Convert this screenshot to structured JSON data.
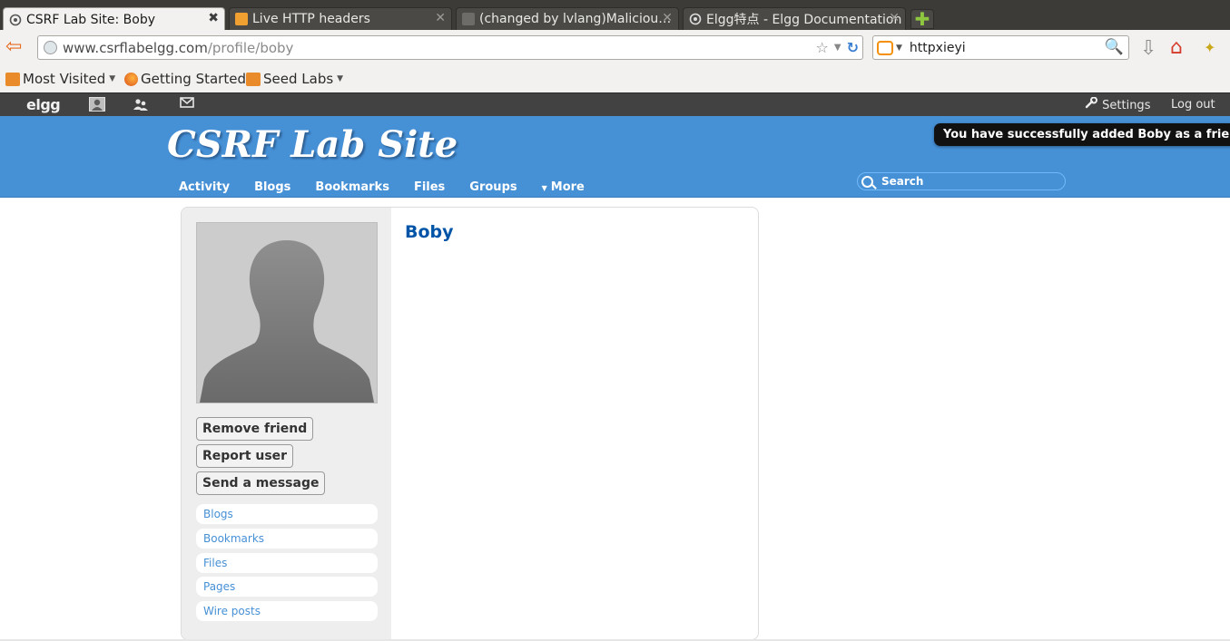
{
  "browser": {
    "tabs": [
      {
        "title": "CSRF Lab Site: Boby",
        "active": true
      },
      {
        "title": "Live HTTP headers",
        "active": false
      },
      {
        "title": "(changed by lvlang)Maliciou…",
        "active": false
      },
      {
        "title": "Elgg特点 - Elgg Documentation",
        "active": false
      }
    ],
    "new_tab_glyph": "✚",
    "url_host": "www.csrflabelgg.com",
    "url_path": "/profile/boby",
    "search_query": "httpxieyi",
    "bookmarks": [
      {
        "label": "Most Visited",
        "dropdown": true
      },
      {
        "label": "Getting Started",
        "dropdown": false
      },
      {
        "label": "Seed Labs",
        "dropdown": true
      }
    ]
  },
  "topbar": {
    "logo": "elgg",
    "settings_label": "Settings",
    "logout_label": "Log out"
  },
  "header": {
    "site_name": "CSRF Lab Site",
    "system_message": "You have successfully added Boby as a friend.",
    "menu": {
      "activity": "Activity",
      "blogs": "Blogs",
      "bookmarks": "Bookmarks",
      "files": "Files",
      "groups": "Groups",
      "more": "More"
    },
    "search_placeholder": "Search"
  },
  "profile": {
    "name": "Boby",
    "actions": {
      "remove_friend": "Remove friend",
      "report_user": "Report user",
      "send_message": "Send a message"
    },
    "owner_links": {
      "blogs": "Blogs",
      "bookmarks": "Bookmarks",
      "files": "Files",
      "pages": "Pages",
      "wire": "Wire posts"
    }
  },
  "colors": {
    "header_blue": "#4690d6",
    "link_blue": "#4690d6",
    "title_blue": "#0054a7",
    "topbar": "#424242"
  }
}
